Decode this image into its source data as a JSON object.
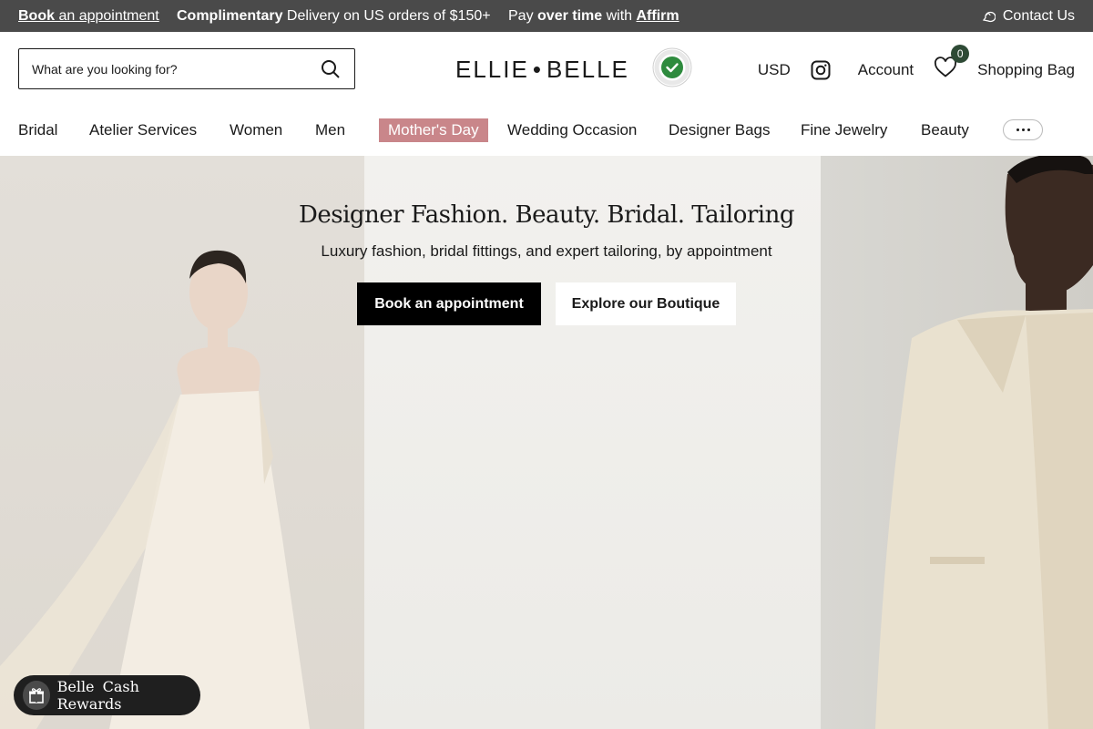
{
  "topbar": {
    "book_bold": "Book",
    "book_rest": " an appointment",
    "delivery_bold": "Complimentary",
    "delivery_rest": " Delivery on US orders of $150+",
    "pay_pre": "Pay ",
    "pay_bold": "over time",
    "pay_mid": " with ",
    "pay_link": "Affirm",
    "contact": "Contact Us"
  },
  "header": {
    "search_placeholder": "What are you looking for?",
    "logo_left": "ELLIE",
    "logo_sep": "•",
    "logo_right": "BELLE",
    "badge_text": "AUTHENTICITY GUARANTEED",
    "currency": "USD",
    "account": "Account",
    "wishlist_count": "0",
    "bag": "Shopping Bag"
  },
  "nav": {
    "items": [
      "Bridal",
      "Atelier Services",
      "Women",
      "Men",
      "Mother's Day",
      "Wedding Occasion",
      "Designer Bags",
      "Fine Jewelry",
      "Beauty"
    ]
  },
  "hero": {
    "title": "Designer Fashion. Beauty. Bridal. Tailoring",
    "subtitle": "Luxury fashion, bridal fittings, and expert tailoring, by appointment",
    "primary_cta": "Book an appointment",
    "secondary_cta": "Explore our Boutique"
  },
  "rewards": {
    "label": "Belle Cash Rewards"
  },
  "colors": {
    "topbar_bg": "#4a4a4a",
    "nav_highlight": "#c9868a",
    "badge_green": "#2e8b3e",
    "cta_primary": "#000000"
  }
}
